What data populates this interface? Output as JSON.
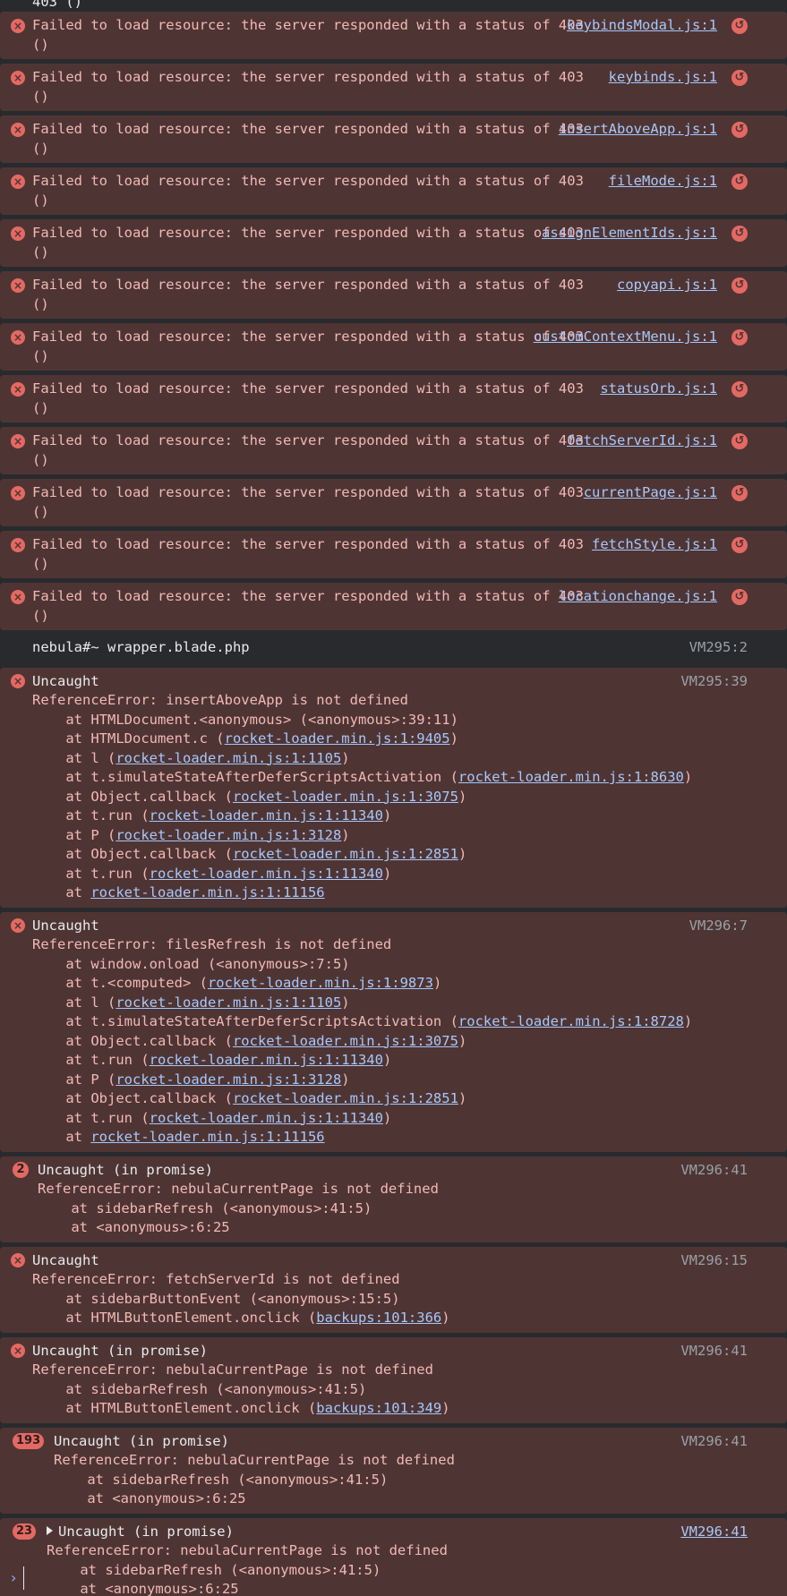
{
  "top_clipped_text": "403 ()",
  "errors": [
    {
      "text": "Failed to load resource: the server responded with a status of 403 ()",
      "source": "keybindsModal.js:1"
    },
    {
      "text": "Failed to load resource: the server responded with a status of 403 ()",
      "source": "keybinds.js:1"
    },
    {
      "text": "Failed to load resource: the server responded with a status of 403 ()",
      "source": "insertAboveApp.js:1"
    },
    {
      "text": "Failed to load resource: the server responded with a status of 403 ()",
      "source": "fileMode.js:1"
    },
    {
      "text": "Failed to load resource: the server responded with a status of 403 ()",
      "source": "assignElementIds.js:1"
    },
    {
      "text": "Failed to load resource: the server responded with a status of 403 ()",
      "source": "copyapi.js:1"
    },
    {
      "text": "Failed to load resource: the server responded with a status of 403 ()",
      "source": "customContextMenu.js:1"
    },
    {
      "text": "Failed to load resource: the server responded with a status of 403 ()",
      "source": "statusOrb.js:1"
    },
    {
      "text": "Failed to load resource: the server responded with a status of 403 ()",
      "source": "fetchServerId.js:1"
    },
    {
      "text": "Failed to load resource: the server responded with a status of 403 ()",
      "source": "currentPage.js:1"
    },
    {
      "text": "Failed to load resource: the server responded with a status of 403 ()",
      "source": "fetchStyle.js:1"
    },
    {
      "text": "Failed to load resource: the server responded with a status of 403 ()",
      "source": "locationchange.js:1"
    }
  ],
  "info_log": {
    "text": "nebula#~ wrapper.blade.php",
    "source": "VM295:2"
  },
  "trace1": {
    "title": "Uncaught",
    "source": "VM295:39",
    "message": "ReferenceError: insertAboveApp is not defined",
    "frames": [
      {
        "pre": "    at HTMLDocument.<anonymous> (<anonymous>:39:11)",
        "link": "",
        "post": ""
      },
      {
        "pre": "    at HTMLDocument.c (",
        "link": "rocket-loader.min.js:1:9405",
        "post": ")"
      },
      {
        "pre": "    at l (",
        "link": "rocket-loader.min.js:1:1105",
        "post": ")"
      },
      {
        "pre": "    at t.simulateStateAfterDeferScriptsActivation (",
        "link": "rocket-loader.min.js:1:8630",
        "post": ")"
      },
      {
        "pre": "    at Object.callback (",
        "link": "rocket-loader.min.js:1:3075",
        "post": ")"
      },
      {
        "pre": "    at t.run (",
        "link": "rocket-loader.min.js:1:11340",
        "post": ")"
      },
      {
        "pre": "    at P (",
        "link": "rocket-loader.min.js:1:3128",
        "post": ")"
      },
      {
        "pre": "    at Object.callback (",
        "link": "rocket-loader.min.js:1:2851",
        "post": ")"
      },
      {
        "pre": "    at t.run (",
        "link": "rocket-loader.min.js:1:11340",
        "post": ")"
      },
      {
        "pre": "    at ",
        "link": "rocket-loader.min.js:1:11156",
        "post": ""
      }
    ]
  },
  "trace2": {
    "title": "Uncaught",
    "source": "VM296:7",
    "message": "ReferenceError: filesRefresh is not defined",
    "frames": [
      {
        "pre": "    at window.onload (<anonymous>:7:5)",
        "link": "",
        "post": ""
      },
      {
        "pre": "    at t.<computed> (",
        "link": "rocket-loader.min.js:1:9873",
        "post": ")"
      },
      {
        "pre": "    at l (",
        "link": "rocket-loader.min.js:1:1105",
        "post": ")"
      },
      {
        "pre": "    at t.simulateStateAfterDeferScriptsActivation (",
        "link": "rocket-loader.min.js:1:8728",
        "post": ")"
      },
      {
        "pre": "    at Object.callback (",
        "link": "rocket-loader.min.js:1:3075",
        "post": ")"
      },
      {
        "pre": "    at t.run (",
        "link": "rocket-loader.min.js:1:11340",
        "post": ")"
      },
      {
        "pre": "    at P (",
        "link": "rocket-loader.min.js:1:3128",
        "post": ")"
      },
      {
        "pre": "    at Object.callback (",
        "link": "rocket-loader.min.js:1:2851",
        "post": ")"
      },
      {
        "pre": "    at t.run (",
        "link": "rocket-loader.min.js:1:11340",
        "post": ")"
      },
      {
        "pre": "    at ",
        "link": "rocket-loader.min.js:1:11156",
        "post": ""
      }
    ]
  },
  "promise1": {
    "count": "2",
    "title": "Uncaught (in promise)",
    "source": "VM296:41",
    "message": "ReferenceError: nebulaCurrentPage is not defined",
    "frames": [
      {
        "pre": "    at sidebarRefresh (<anonymous>:41:5)",
        "link": "",
        "post": ""
      },
      {
        "pre": "    at <anonymous>:6:25",
        "link": "",
        "post": ""
      }
    ]
  },
  "trace3": {
    "title": "Uncaught",
    "source": "VM296:15",
    "message": "ReferenceError: fetchServerId is not defined",
    "frames": [
      {
        "pre": "    at sidebarButtonEvent (<anonymous>:15:5)",
        "link": "",
        "post": ""
      },
      {
        "pre": "    at HTMLButtonElement.onclick (",
        "link": "backups:101:366",
        "post": ")"
      }
    ]
  },
  "trace4": {
    "title": "Uncaught (in promise)",
    "source": "VM296:41",
    "message": "ReferenceError: nebulaCurrentPage is not defined",
    "frames": [
      {
        "pre": "    at sidebarRefresh (<anonymous>:41:5)",
        "link": "",
        "post": ""
      },
      {
        "pre": "    at HTMLButtonElement.onclick (",
        "link": "backups:101:349",
        "post": ")"
      }
    ]
  },
  "promise2": {
    "count": "193",
    "title": "Uncaught (in promise)",
    "source": "VM296:41",
    "message": "ReferenceError: nebulaCurrentPage is not defined",
    "frames": [
      {
        "pre": "    at sidebarRefresh (<anonymous>:41:5)",
        "link": "",
        "post": ""
      },
      {
        "pre": "    at <anonymous>:6:25",
        "link": "",
        "post": ""
      }
    ]
  },
  "promise3": {
    "count": "23",
    "title": "Uncaught (in promise)",
    "source": "VM296:41",
    "message": "ReferenceError: nebulaCurrentPage is not defined",
    "frames": [
      {
        "pre": "    at sidebarRefresh (<anonymous>:41:5)",
        "link": "",
        "post": ""
      },
      {
        "pre": "    at <anonymous>:6:25",
        "link": "",
        "post": ""
      }
    ]
  },
  "prompt": {
    "chevron": "›",
    "value": ""
  },
  "icons": {
    "error": "×",
    "reload": "↺"
  },
  "colors": {
    "background": "#292a2d",
    "error_bg": "#4e3534",
    "error_text": "#f2b8b5",
    "link": "#a8c7fa",
    "error_icon": "#e46962"
  }
}
